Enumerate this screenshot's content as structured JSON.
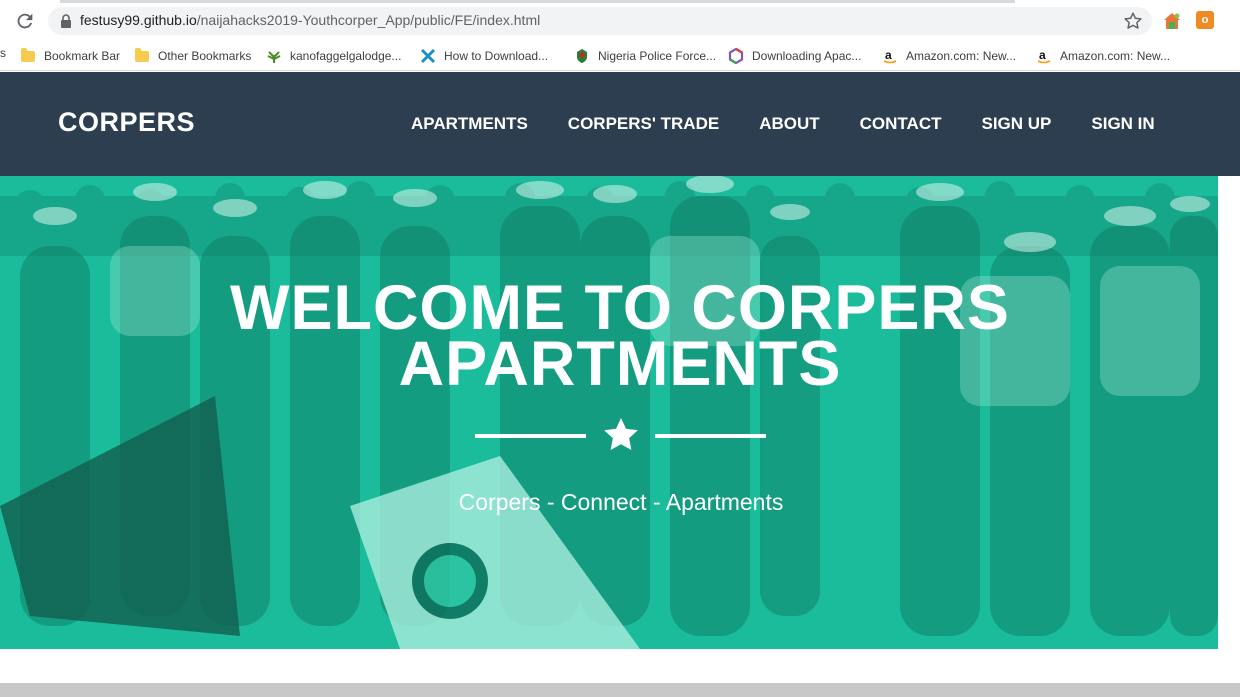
{
  "browser": {
    "url_domain": "festusy99.github.io",
    "url_path": "/naijahacks2019-Youthcorper_App/public/FE/index.html",
    "extension_badge": "o",
    "bookmarks_edge": "s",
    "bookmarks": [
      {
        "label": "Bookmark Bar",
        "icon": "folder-icon"
      },
      {
        "label": "Other Bookmarks",
        "icon": "folder-icon"
      },
      {
        "label": "kanofaggelgalodge...",
        "icon": "plant-icon"
      },
      {
        "label": "How to Download...",
        "icon": "x-logo-icon"
      },
      {
        "label": "Nigeria Police Force...",
        "icon": "police-crest-icon"
      },
      {
        "label": "Downloading Apac...",
        "icon": "hexagon-icon"
      },
      {
        "label": "Amazon.com: New...",
        "icon": "amazon-icon"
      },
      {
        "label": "Amazon.com: New...",
        "icon": "amazon-icon"
      }
    ]
  },
  "site": {
    "brand": "CORPERS",
    "nav": [
      "APARTMENTS",
      "CORPERS' TRADE",
      "ABOUT",
      "CONTACT",
      "SIGN UP",
      "SIGN IN"
    ],
    "hero": {
      "title_line1": "WELCOME TO CORPERS",
      "title_line2": "APARTMENTS",
      "subtitle": "Corpers - Connect - Apartments"
    }
  },
  "colors": {
    "nav_bg": "#2c3e50",
    "hero_overlay": "#1abc9c",
    "text_light": "#ffffff"
  }
}
